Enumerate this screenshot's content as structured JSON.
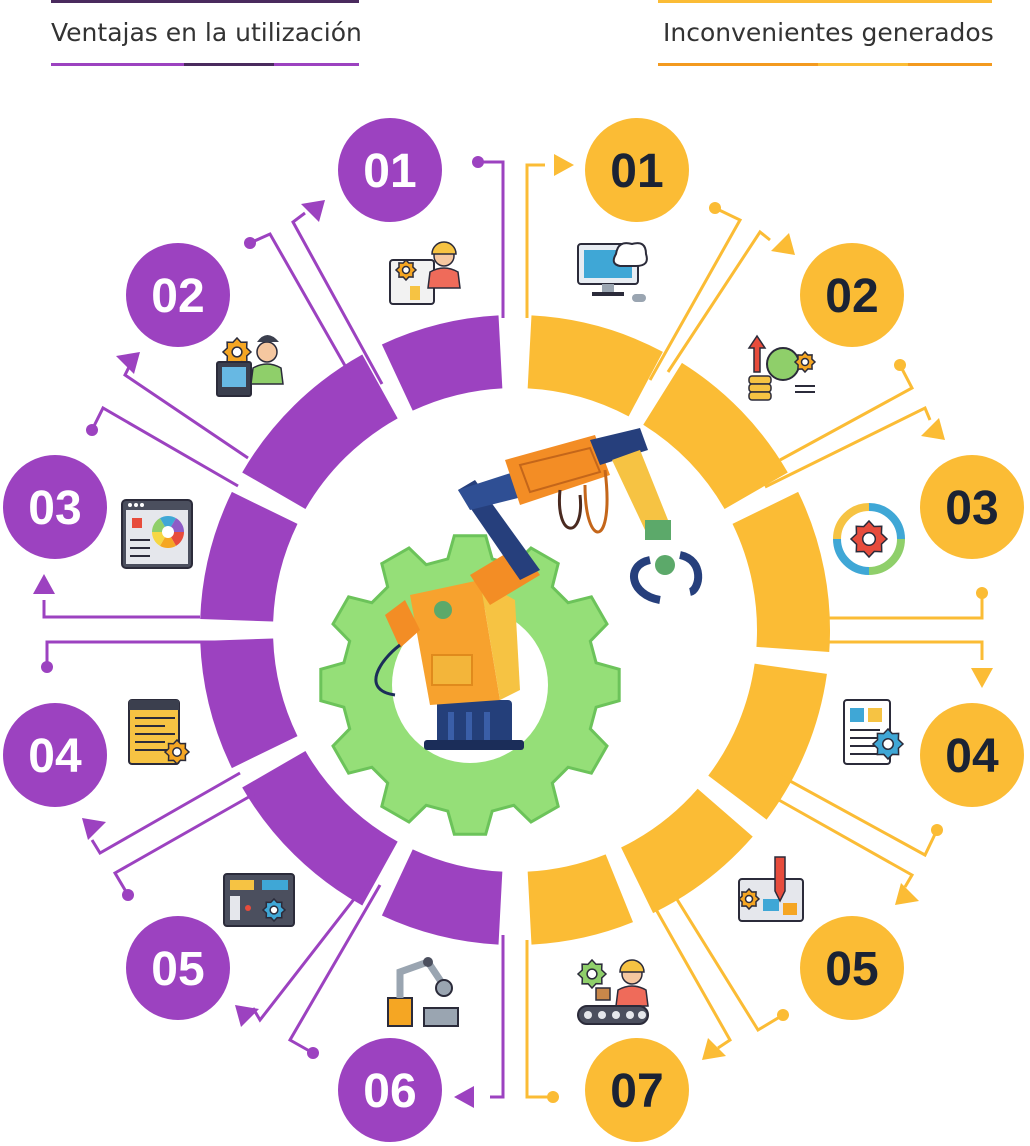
{
  "legend": {
    "advantages_title": "Ventajas en la utilización",
    "disadvantages_title": "Inconvenientes generados"
  },
  "colors": {
    "advantages": "#9c42c0",
    "advantages_dark": "#4a2a5e",
    "disadvantages": "#fbbc35",
    "disadvantages_dark": "#f39a1f",
    "number_on_purple": "#ffffff",
    "number_on_yellow": "#1b2334",
    "gear": "#95df78",
    "gear_outline": "#6cc35a"
  },
  "advantages": [
    {
      "number": "01",
      "icon": "engineer-with-machine-icon"
    },
    {
      "number": "02",
      "icon": "operator-at-computer-icon"
    },
    {
      "number": "03",
      "icon": "control-panel-icon"
    },
    {
      "number": "04",
      "icon": "code-document-icon"
    },
    {
      "number": "05",
      "icon": "circuit-board-icon"
    },
    {
      "number": "06",
      "icon": "robot-arm-icon"
    }
  ],
  "disadvantages": [
    {
      "number": "01",
      "icon": "computer-cloud-icon"
    },
    {
      "number": "02",
      "icon": "rising-cost-icon"
    },
    {
      "number": "03",
      "icon": "gear-cycle-icon"
    },
    {
      "number": "04",
      "icon": "documents-gear-icon"
    },
    {
      "number": "05",
      "icon": "blueprint-pencil-icon"
    },
    {
      "number": "07",
      "icon": "factory-worker-conveyor-icon"
    }
  ],
  "center": {
    "icon": "industrial-robot-arm-gear-icon"
  }
}
